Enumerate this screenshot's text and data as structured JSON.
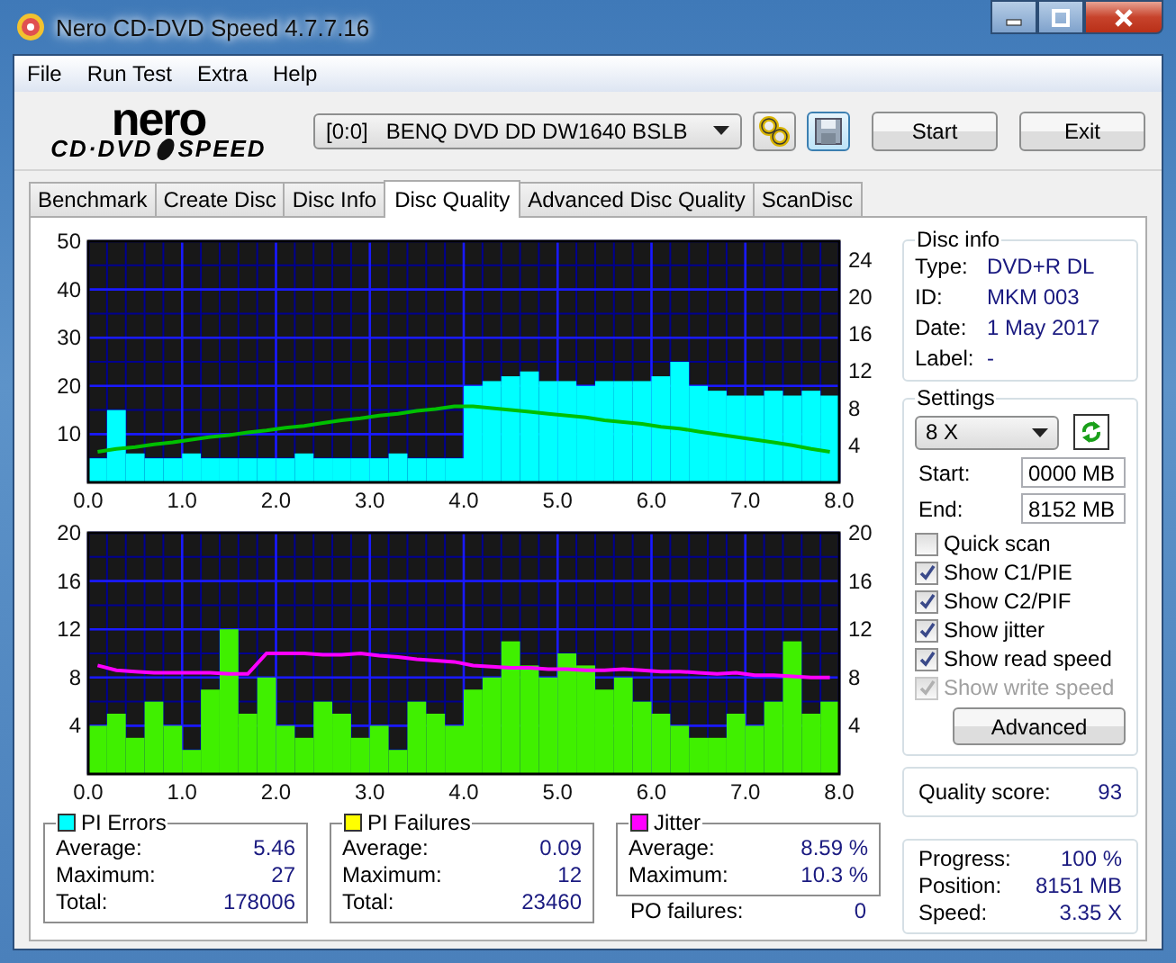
{
  "window": {
    "title": "Nero CD-DVD Speed 4.7.7.16"
  },
  "menu": [
    "File",
    "Run Test",
    "Extra",
    "Help"
  ],
  "logo": {
    "top": "nero",
    "left": "CD·DVD",
    "right": "SPEED"
  },
  "toolbar": {
    "drive_id": "[0:0]",
    "drive_name": "BENQ DVD DD DW1640 BSLB",
    "buttons": [
      "Start",
      "Exit"
    ]
  },
  "tabs": [
    {
      "label": "Benchmark",
      "selected": false
    },
    {
      "label": "Create Disc",
      "selected": false
    },
    {
      "label": "Disc Info",
      "selected": false
    },
    {
      "label": "Disc Quality",
      "selected": true
    },
    {
      "label": "Advanced Disc Quality",
      "selected": false
    },
    {
      "label": "ScanDisc",
      "selected": false
    }
  ],
  "charts": [
    {
      "chart_data": {
        "type": "bar",
        "grid": true,
        "xlim": [
          0,
          8
        ],
        "ylim": [
          0,
          50
        ],
        "y2lim": [
          0,
          26
        ],
        "x": [
          0.1,
          0.3,
          0.5,
          0.7,
          0.9,
          1.1,
          1.3,
          1.5,
          1.7,
          1.9,
          2.1,
          2.3,
          2.5,
          2.7,
          2.9,
          3.1,
          3.3,
          3.5,
          3.7,
          3.9,
          4.1,
          4.3,
          4.5,
          4.7,
          4.9,
          5.1,
          5.3,
          5.5,
          5.7,
          5.9,
          6.1,
          6.3,
          6.5,
          6.7,
          6.9,
          7.1,
          7.3,
          7.5,
          7.7,
          7.9
        ],
        "series": [
          {
            "color": "#00ffff",
            "values": [
              5,
              15,
              6,
              5,
              5,
              6,
              5,
              5,
              5,
              5,
              5,
              6,
              5,
              5,
              5,
              5,
              6,
              5,
              5,
              5,
              20,
              21,
              22,
              23,
              21,
              21,
              20,
              21,
              21,
              21,
              22,
              25,
              20,
              19,
              18,
              18,
              19,
              18,
              19,
              18
            ]
          },
          {
            "type": "line",
            "axis": "y2",
            "color": "#00c000",
            "values": [
              3.3,
              3.6,
              3.8,
              4.1,
              4.3,
              4.6,
              4.9,
              5.1,
              5.4,
              5.6,
              5.9,
              6.1,
              6.4,
              6.7,
              6.9,
              7.2,
              7.4,
              7.7,
              7.9,
              8.2,
              8.2,
              8,
              7.8,
              7.6,
              7.4,
              7.2,
              7,
              6.7,
              6.5,
              6.3,
              6,
              5.8,
              5.5,
              5.2,
              4.9,
              4.6,
              4.3,
              4,
              3.6,
              3.3
            ]
          }
        ],
        "xticks": [
          {
            "value": 0,
            "label": "0.0"
          },
          {
            "value": 1,
            "label": "1.0"
          },
          {
            "value": 2,
            "label": "2.0"
          },
          {
            "value": 3,
            "label": "3.0"
          },
          {
            "value": 4,
            "label": "4.0"
          },
          {
            "value": 5,
            "label": "5.0"
          },
          {
            "value": 6,
            "label": "6.0"
          },
          {
            "value": 7,
            "label": "7.0"
          },
          {
            "value": 8,
            "label": "8.0"
          }
        ],
        "yticks": [
          10,
          20,
          30,
          40,
          50
        ],
        "y2ticks": [
          4,
          8,
          12,
          16,
          20,
          24
        ]
      }
    },
    {
      "chart_data": {
        "type": "bar",
        "grid": true,
        "xlim": [
          0,
          8
        ],
        "ylim": [
          0,
          20
        ],
        "y2lim": [
          0,
          20
        ],
        "x": [
          0.1,
          0.3,
          0.5,
          0.7,
          0.9,
          1.1,
          1.3,
          1.5,
          1.7,
          1.9,
          2.1,
          2.3,
          2.5,
          2.7,
          2.9,
          3.1,
          3.3,
          3.5,
          3.7,
          3.9,
          4.1,
          4.3,
          4.5,
          4.7,
          4.9,
          5.1,
          5.3,
          5.5,
          5.7,
          5.9,
          6.1,
          6.3,
          6.5,
          6.7,
          6.9,
          7.1,
          7.3,
          7.5,
          7.7,
          7.9
        ],
        "series": [
          {
            "color": "#40f000",
            "values": [
              4,
              5,
              3,
              6,
              4,
              2,
              7,
              12,
              5,
              8,
              4,
              3,
              6,
              5,
              3,
              4,
              2,
              6,
              5,
              4,
              7,
              8,
              11,
              9,
              8,
              10,
              9,
              7,
              8,
              6,
              5,
              4,
              3,
              3,
              5,
              4,
              6,
              11,
              5,
              6
            ]
          },
          {
            "type": "line",
            "axis": "y2",
            "color": "#ff00ff",
            "values": [
              9,
              8.6,
              8.5,
              8.4,
              8.4,
              8.4,
              8.4,
              8.3,
              8.3,
              10,
              10,
              10,
              9.9,
              9.9,
              10,
              9.8,
              9.7,
              9.5,
              9.4,
              9.3,
              9,
              8.9,
              8.8,
              8.8,
              8.7,
              8.7,
              8.6,
              8.6,
              8.7,
              8.6,
              8.5,
              8.5,
              8.4,
              8.3,
              8.4,
              8.2,
              8.2,
              8.1,
              8,
              8
            ]
          }
        ],
        "xticks": [
          {
            "value": 0,
            "label": "0.0"
          },
          {
            "value": 1,
            "label": "1.0"
          },
          {
            "value": 2,
            "label": "2.0"
          },
          {
            "value": 3,
            "label": "3.0"
          },
          {
            "value": 4,
            "label": "4.0"
          },
          {
            "value": 5,
            "label": "5.0"
          },
          {
            "value": 6,
            "label": "6.0"
          },
          {
            "value": 7,
            "label": "7.0"
          },
          {
            "value": 8,
            "label": "8.0"
          }
        ],
        "yticks": [
          4,
          8,
          12,
          16,
          20
        ],
        "y2ticks": [
          4,
          8,
          12,
          16,
          20
        ]
      }
    }
  ],
  "disc_info": {
    "title": "Disc info",
    "rows": [
      {
        "label": "Type:",
        "value": "DVD+R DL"
      },
      {
        "label": "ID:",
        "value": "MKM 003"
      },
      {
        "label": "Date:",
        "value": "1 May 2017"
      },
      {
        "label": "Label:",
        "value": "-"
      }
    ]
  },
  "settings": {
    "title": "Settings",
    "speed": "8 X",
    "start_label": "Start:",
    "start": "0000 MB",
    "end_label": "End:",
    "end": "8152 MB",
    "options": [
      {
        "label": "Quick scan",
        "checked": false,
        "disabled": false
      },
      {
        "label": "Show C1/PIE",
        "checked": true,
        "disabled": false
      },
      {
        "label": "Show C2/PIF",
        "checked": true,
        "disabled": false
      },
      {
        "label": "Show jitter",
        "checked": true,
        "disabled": false
      },
      {
        "label": "Show read speed",
        "checked": true,
        "disabled": false
      },
      {
        "label": "Show write speed",
        "checked": true,
        "disabled": true
      }
    ],
    "advanced": "Advanced"
  },
  "quality": {
    "label": "Quality score:",
    "value": "93"
  },
  "stats": [
    {
      "title": "PI Errors",
      "color": "#00ffff",
      "rows": [
        {
          "label": "Average:",
          "value": "5.46"
        },
        {
          "label": "Maximum:",
          "value": "27"
        },
        {
          "label": "Total:",
          "value": "178006"
        }
      ]
    },
    {
      "title": "PI Failures",
      "color": "#ffff00",
      "rows": [
        {
          "label": "Average:",
          "value": "0.09"
        },
        {
          "label": "Maximum:",
          "value": "12"
        },
        {
          "label": "Total:",
          "value": "23460"
        }
      ]
    },
    {
      "title": "Jitter",
      "color": "#ff00ff",
      "rows": [
        {
          "label": "Average:",
          "value": "8.59 %"
        },
        {
          "label": "Maximum:",
          "value": "10.3 %"
        }
      ]
    }
  ],
  "po_failures": {
    "label": "PO failures:",
    "value": "0"
  },
  "progress": [
    {
      "label": "Progress:",
      "value": "100 %"
    },
    {
      "label": "Position:",
      "value": "8151 MB"
    },
    {
      "label": "Speed:",
      "value": "3.35 X"
    }
  ]
}
